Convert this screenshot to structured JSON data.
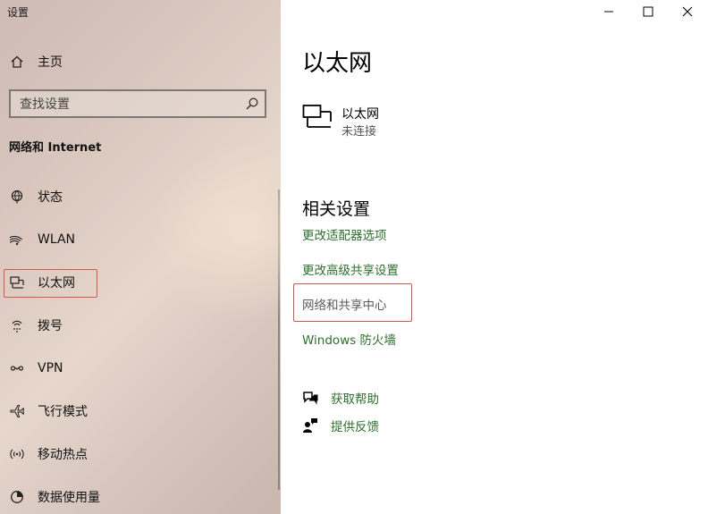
{
  "window": {
    "title": "设置"
  },
  "sidebar": {
    "home_label": "主页",
    "search_placeholder": "查找设置",
    "section_title": "网络和 Internet",
    "items": [
      {
        "label": "状态",
        "icon": "status-globe-icon"
      },
      {
        "label": "WLAN",
        "icon": "wifi-icon"
      },
      {
        "label": "以太网",
        "icon": "ethernet-icon"
      },
      {
        "label": "拨号",
        "icon": "dialup-icon"
      },
      {
        "label": "VPN",
        "icon": "vpn-icon"
      },
      {
        "label": "飞行模式",
        "icon": "airplane-icon"
      },
      {
        "label": "移动热点",
        "icon": "hotspot-icon"
      },
      {
        "label": "数据使用量",
        "icon": "data-usage-icon"
      }
    ],
    "selected": "以太网"
  },
  "main": {
    "title": "以太网",
    "adapter": {
      "name": "以太网",
      "status": "未连接"
    },
    "related_title": "相关设置",
    "related_links": [
      "更改适配器选项",
      "更改高级共享设置",
      "网络和共享中心",
      "Windows 防火墙"
    ],
    "help_links": [
      {
        "label": "获取帮助",
        "icon": "help-chat-icon"
      },
      {
        "label": "提供反馈",
        "icon": "feedback-icon"
      }
    ]
  },
  "colors": {
    "link": "#2e6e2e",
    "highlight": "#d9534f"
  }
}
